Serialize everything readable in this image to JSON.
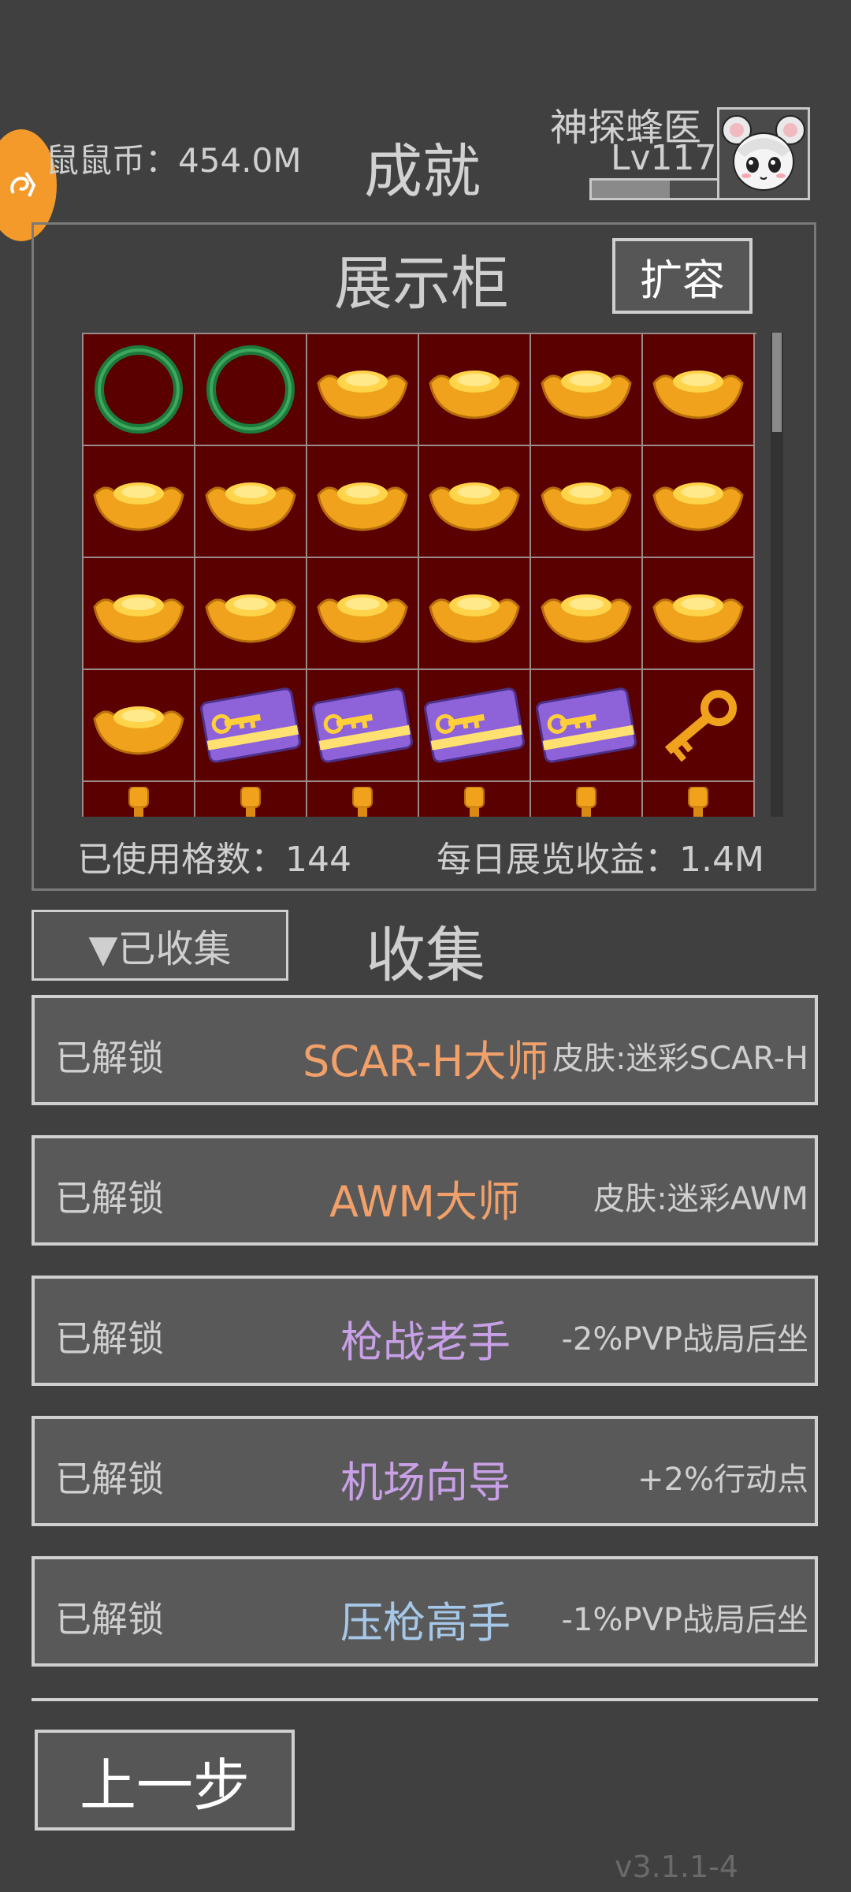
{
  "header": {
    "coins_label": "鼠鼠币：454.0M",
    "title": "成就",
    "player_name": "神探蜂医",
    "player_level": "Lv117",
    "xp_progress": 0.62
  },
  "showcase": {
    "title": "展示柜",
    "expand_label": "扩容",
    "used_slots_label": "已使用格数：144",
    "daily_income_label": "每日展览收益：1.4M",
    "rows": [
      [
        "jade-bracelet",
        "jade-bracelet",
        "gold-ingot",
        "gold-ingot",
        "gold-ingot",
        "gold-ingot"
      ],
      [
        "gold-ingot",
        "gold-ingot",
        "gold-ingot",
        "gold-ingot",
        "gold-ingot",
        "gold-ingot"
      ],
      [
        "gold-ingot",
        "gold-ingot",
        "gold-ingot",
        "gold-ingot",
        "gold-ingot",
        "gold-ingot"
      ],
      [
        "gold-ingot",
        "purple-keycard",
        "purple-keycard",
        "purple-keycard",
        "purple-keycard",
        "gold-key"
      ],
      [
        "gold-item",
        "gold-item",
        "gold-item",
        "gold-item",
        "gold-item",
        "gold-item"
      ]
    ]
  },
  "collection": {
    "filter_label": "▼已收集",
    "title": "收集",
    "items": [
      {
        "status": "已解锁",
        "name": "SCAR-H大师",
        "reward": "皮肤:迷彩SCAR-H",
        "color": "#f2a06a"
      },
      {
        "status": "已解锁",
        "name": "AWM大师",
        "reward": "皮肤:迷彩AWM",
        "color": "#f2a06a"
      },
      {
        "status": "已解锁",
        "name": "枪战老手",
        "reward": "-2%PVP战局后坐",
        "color": "#c8a0e6"
      },
      {
        "status": "已解锁",
        "name": "机场向导",
        "reward": "+2%行动点",
        "color": "#c8a0e6"
      },
      {
        "status": "已解锁",
        "name": "压枪高手",
        "reward": "-1%PVP战局后坐",
        "color": "#a6c8e8"
      }
    ]
  },
  "footer": {
    "back_label": "上一步",
    "version": "v3.1.1-4"
  }
}
